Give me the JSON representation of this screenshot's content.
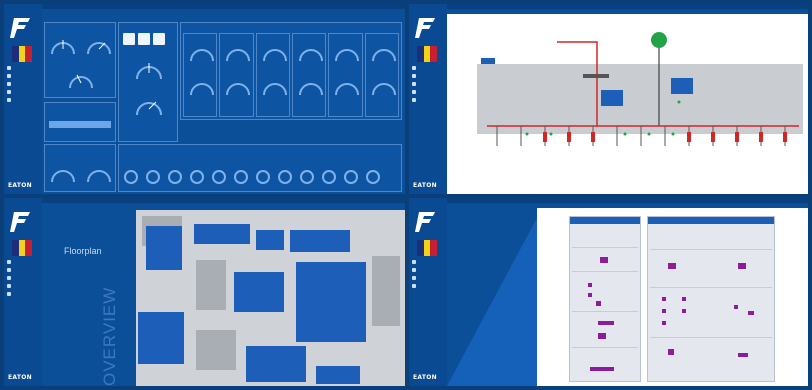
{
  "colors": {
    "navy": "#0b3f79",
    "panel": "#0c4f99",
    "accent_red": "#d32626",
    "accent_green": "#22a34a",
    "accent_purple": "#8c1c9e",
    "light_blue": "#6aa6e8"
  },
  "sidebar": {
    "brand_mark": "EATON",
    "nav_items": [
      {
        "icon": "home-icon",
        "label": ""
      },
      {
        "icon": "devices-icon",
        "label": ""
      },
      {
        "icon": "alarms-icon",
        "label": ""
      },
      {
        "icon": "trends-icon",
        "label": ""
      },
      {
        "icon": "settings-icon",
        "label": ""
      }
    ]
  },
  "panels": [
    {
      "id": "p1",
      "view": "dashboard"
    },
    {
      "id": "p2",
      "view": "single-line-diagram"
    },
    {
      "id": "p3",
      "view": "floorplan",
      "title": "Floorplan",
      "watermark": "OVERVIEW"
    },
    {
      "id": "p4",
      "view": "switchboard-layout",
      "columns": [
        "",
        ""
      ]
    }
  ]
}
